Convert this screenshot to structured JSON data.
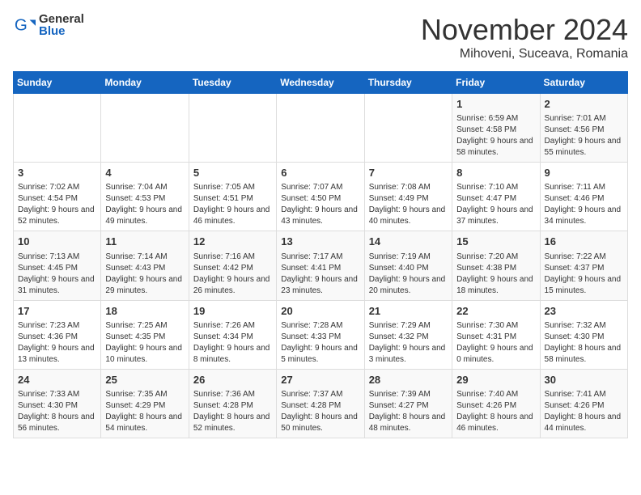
{
  "logo": {
    "general": "General",
    "blue": "Blue"
  },
  "title": "November 2024",
  "location": "Mihoveni, Suceava, Romania",
  "days_of_week": [
    "Sunday",
    "Monday",
    "Tuesday",
    "Wednesday",
    "Thursday",
    "Friday",
    "Saturday"
  ],
  "weeks": [
    [
      {
        "day": "",
        "info": ""
      },
      {
        "day": "",
        "info": ""
      },
      {
        "day": "",
        "info": ""
      },
      {
        "day": "",
        "info": ""
      },
      {
        "day": "",
        "info": ""
      },
      {
        "day": "1",
        "info": "Sunrise: 6:59 AM\nSunset: 4:58 PM\nDaylight: 9 hours and 58 minutes."
      },
      {
        "day": "2",
        "info": "Sunrise: 7:01 AM\nSunset: 4:56 PM\nDaylight: 9 hours and 55 minutes."
      }
    ],
    [
      {
        "day": "3",
        "info": "Sunrise: 7:02 AM\nSunset: 4:54 PM\nDaylight: 9 hours and 52 minutes."
      },
      {
        "day": "4",
        "info": "Sunrise: 7:04 AM\nSunset: 4:53 PM\nDaylight: 9 hours and 49 minutes."
      },
      {
        "day": "5",
        "info": "Sunrise: 7:05 AM\nSunset: 4:51 PM\nDaylight: 9 hours and 46 minutes."
      },
      {
        "day": "6",
        "info": "Sunrise: 7:07 AM\nSunset: 4:50 PM\nDaylight: 9 hours and 43 minutes."
      },
      {
        "day": "7",
        "info": "Sunrise: 7:08 AM\nSunset: 4:49 PM\nDaylight: 9 hours and 40 minutes."
      },
      {
        "day": "8",
        "info": "Sunrise: 7:10 AM\nSunset: 4:47 PM\nDaylight: 9 hours and 37 minutes."
      },
      {
        "day": "9",
        "info": "Sunrise: 7:11 AM\nSunset: 4:46 PM\nDaylight: 9 hours and 34 minutes."
      }
    ],
    [
      {
        "day": "10",
        "info": "Sunrise: 7:13 AM\nSunset: 4:45 PM\nDaylight: 9 hours and 31 minutes."
      },
      {
        "day": "11",
        "info": "Sunrise: 7:14 AM\nSunset: 4:43 PM\nDaylight: 9 hours and 29 minutes."
      },
      {
        "day": "12",
        "info": "Sunrise: 7:16 AM\nSunset: 4:42 PM\nDaylight: 9 hours and 26 minutes."
      },
      {
        "day": "13",
        "info": "Sunrise: 7:17 AM\nSunset: 4:41 PM\nDaylight: 9 hours and 23 minutes."
      },
      {
        "day": "14",
        "info": "Sunrise: 7:19 AM\nSunset: 4:40 PM\nDaylight: 9 hours and 20 minutes."
      },
      {
        "day": "15",
        "info": "Sunrise: 7:20 AM\nSunset: 4:38 PM\nDaylight: 9 hours and 18 minutes."
      },
      {
        "day": "16",
        "info": "Sunrise: 7:22 AM\nSunset: 4:37 PM\nDaylight: 9 hours and 15 minutes."
      }
    ],
    [
      {
        "day": "17",
        "info": "Sunrise: 7:23 AM\nSunset: 4:36 PM\nDaylight: 9 hours and 13 minutes."
      },
      {
        "day": "18",
        "info": "Sunrise: 7:25 AM\nSunset: 4:35 PM\nDaylight: 9 hours and 10 minutes."
      },
      {
        "day": "19",
        "info": "Sunrise: 7:26 AM\nSunset: 4:34 PM\nDaylight: 9 hours and 8 minutes."
      },
      {
        "day": "20",
        "info": "Sunrise: 7:28 AM\nSunset: 4:33 PM\nDaylight: 9 hours and 5 minutes."
      },
      {
        "day": "21",
        "info": "Sunrise: 7:29 AM\nSunset: 4:32 PM\nDaylight: 9 hours and 3 minutes."
      },
      {
        "day": "22",
        "info": "Sunrise: 7:30 AM\nSunset: 4:31 PM\nDaylight: 9 hours and 0 minutes."
      },
      {
        "day": "23",
        "info": "Sunrise: 7:32 AM\nSunset: 4:30 PM\nDaylight: 8 hours and 58 minutes."
      }
    ],
    [
      {
        "day": "24",
        "info": "Sunrise: 7:33 AM\nSunset: 4:30 PM\nDaylight: 8 hours and 56 minutes."
      },
      {
        "day": "25",
        "info": "Sunrise: 7:35 AM\nSunset: 4:29 PM\nDaylight: 8 hours and 54 minutes."
      },
      {
        "day": "26",
        "info": "Sunrise: 7:36 AM\nSunset: 4:28 PM\nDaylight: 8 hours and 52 minutes."
      },
      {
        "day": "27",
        "info": "Sunrise: 7:37 AM\nSunset: 4:28 PM\nDaylight: 8 hours and 50 minutes."
      },
      {
        "day": "28",
        "info": "Sunrise: 7:39 AM\nSunset: 4:27 PM\nDaylight: 8 hours and 48 minutes."
      },
      {
        "day": "29",
        "info": "Sunrise: 7:40 AM\nSunset: 4:26 PM\nDaylight: 8 hours and 46 minutes."
      },
      {
        "day": "30",
        "info": "Sunrise: 7:41 AM\nSunset: 4:26 PM\nDaylight: 8 hours and 44 minutes."
      }
    ]
  ]
}
